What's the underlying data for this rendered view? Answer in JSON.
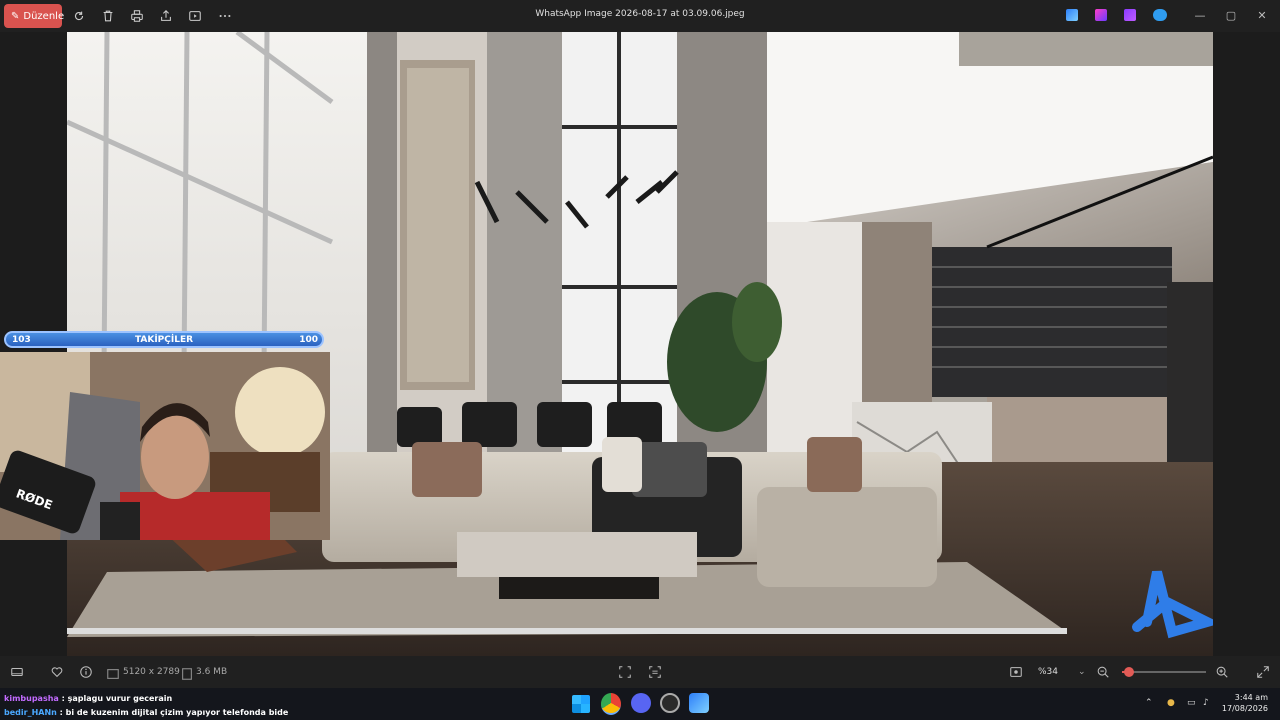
{
  "titlebar": {
    "edit_label": "Düzenle",
    "title": "WhatsApp Image 2026-08-17 at 03.09.06.jpeg",
    "icons": [
      "rotate-icon",
      "delete-icon",
      "print-icon",
      "share-icon",
      "slideshow-icon",
      "more-icon"
    ],
    "window_controls": [
      "—",
      "▢",
      "✕"
    ]
  },
  "stream": {
    "follow_left": "103",
    "follow_label": "TAKİPÇİLER",
    "follow_right": "100",
    "mic_brand": "RØDE"
  },
  "bottombar": {
    "dimensions": "5120 x 2789",
    "file_size": "3.6 MB",
    "zoom": "%34",
    "zoom_fraction": 0.08
  },
  "chat": [
    {
      "user": "kimbupasha",
      "message": " : şaplagu vurur gecerain"
    },
    {
      "user": "bedir_HANn",
      "message": " : bi de kuzenim dijital çizim yapıyor telefonda bide"
    }
  ],
  "clock": {
    "time": "3:44 am",
    "date": "17/08/2026"
  },
  "colors": {
    "accent": "#d9534f",
    "follow_bar": "#2b62c0",
    "taskbar": "#14161c"
  }
}
